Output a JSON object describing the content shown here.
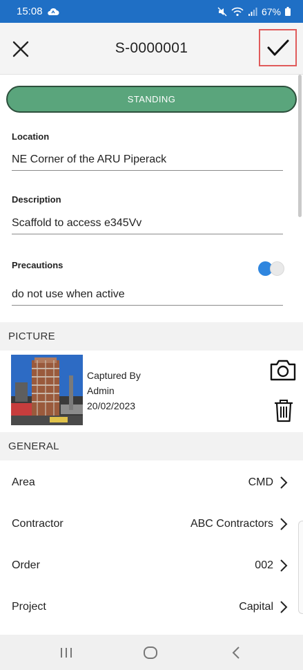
{
  "status_bar": {
    "time": "15:08",
    "battery": "67%"
  },
  "header": {
    "title": "S-0000001"
  },
  "scaffold": {
    "status": "STANDING",
    "status_color": "#5aa57c",
    "location_label": "Location",
    "location_value": "NE Corner of the ARU Piperack",
    "description_label": "Description",
    "description_value": "Scaffold to access e345Vv",
    "precautions_label": "Precautions",
    "precautions_value": "do not use when active",
    "precautions_toggle": "on"
  },
  "picture": {
    "section_title": "PICTURE",
    "captured_by_label": "Captured By",
    "captured_by": "Admin",
    "date": "20/02/2023"
  },
  "general": {
    "section_title": "GENERAL",
    "rows": [
      {
        "label": "Area",
        "value": "CMD"
      },
      {
        "label": "Contractor",
        "value": "ABC Contractors"
      },
      {
        "label": "Order",
        "value": "002"
      },
      {
        "label": "Project",
        "value": "Capital"
      }
    ]
  },
  "icons": {
    "close": "close-icon",
    "confirm": "checkmark-icon",
    "camera": "camera-icon",
    "trash": "trash-icon",
    "chevron": "chevron-right-icon"
  },
  "colors": {
    "accent": "#1f6fc5",
    "toggle_on": "#2f86df",
    "highlight_border": "#e05a5a"
  }
}
